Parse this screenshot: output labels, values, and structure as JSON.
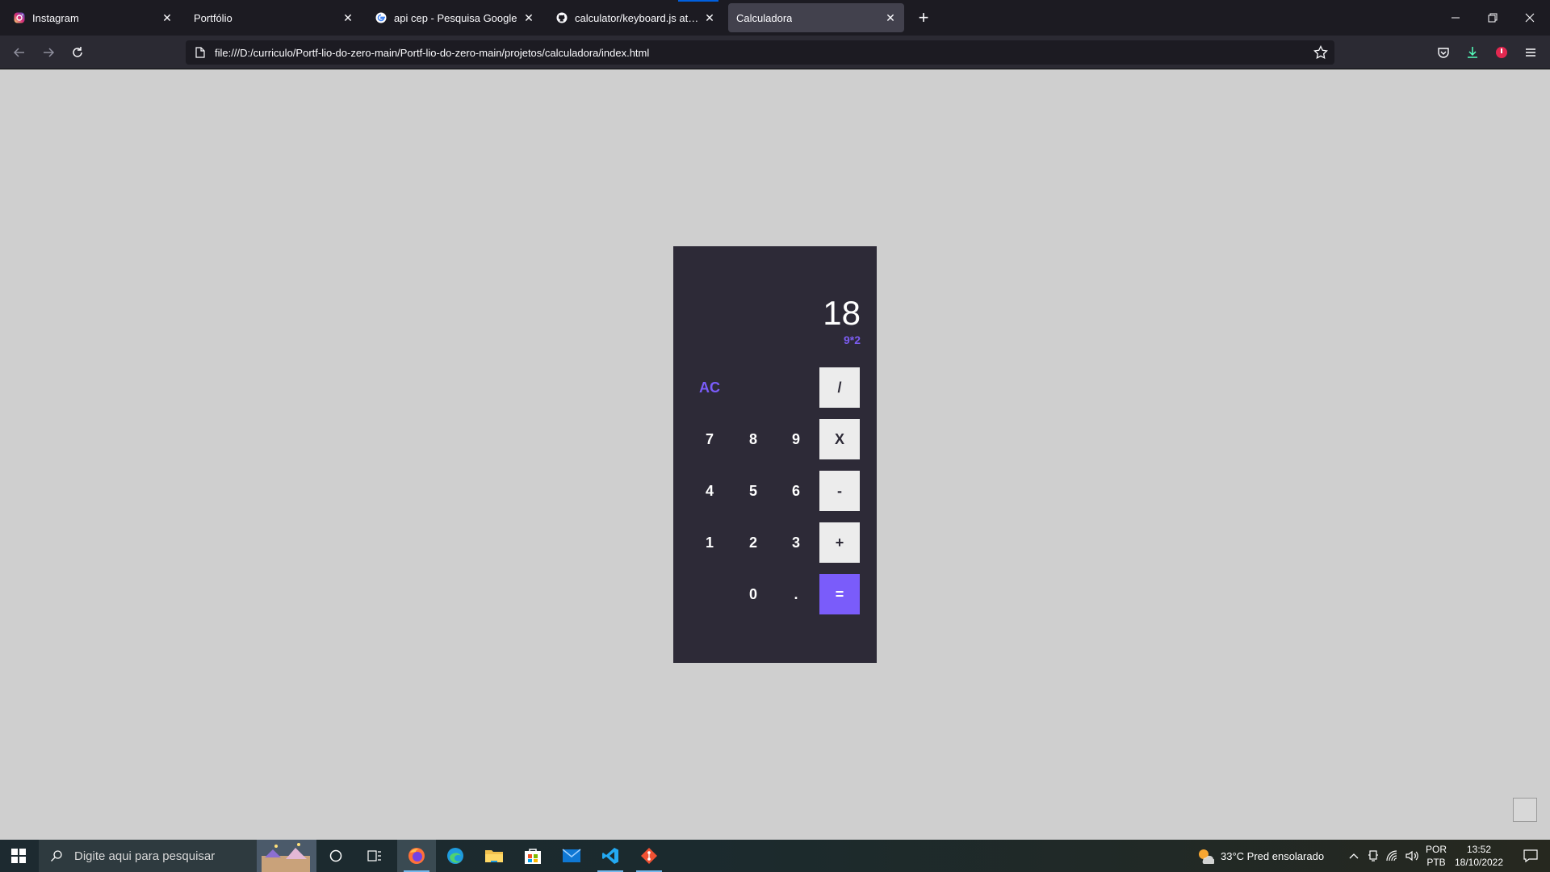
{
  "browser": {
    "tabs": [
      {
        "title": "Instagram",
        "icon": "instagram-icon",
        "active": false
      },
      {
        "title": "Portfólio",
        "icon": "none",
        "active": false
      },
      {
        "title": "api cep - Pesquisa Google",
        "icon": "google-icon",
        "active": false
      },
      {
        "title": "calculator/keyboard.js at main · ",
        "icon": "github-icon",
        "active": false
      },
      {
        "title": "Calculadora",
        "icon": "none",
        "active": true
      }
    ],
    "url": "file:///D:/curriculo/Portf-lio-do-zero-main/Portf-lio-do-zero-main/projetos/calculadora/index.html",
    "accent_color": "#0060df"
  },
  "calculator": {
    "result": "18",
    "expression": "9*2",
    "keys": {
      "ac": "AC",
      "divide": "/",
      "multiply": "X",
      "minus": "-",
      "plus": "+",
      "equals": "=",
      "dot": ".",
      "k0": "0",
      "k1": "1",
      "k2": "2",
      "k3": "3",
      "k4": "4",
      "k5": "5",
      "k6": "6",
      "k7": "7",
      "k8": "8",
      "k9": "9"
    },
    "colors": {
      "panel": "#2d2a37",
      "accent": "#7a5cfa",
      "operator_bg": "#ececec",
      "page_bg": "#cfcfcf"
    }
  },
  "taskbar": {
    "search_placeholder": "Digite aqui para pesquisar",
    "weather": "33°C  Pred ensolarado",
    "lang_top": "POR",
    "lang_bottom": "PTB",
    "time": "13:52",
    "date": "18/10/2022",
    "apps": [
      "firefox-icon",
      "edge-icon",
      "file-explorer-icon",
      "store-icon",
      "mail-icon",
      "vscode-icon",
      "git-icon"
    ]
  }
}
